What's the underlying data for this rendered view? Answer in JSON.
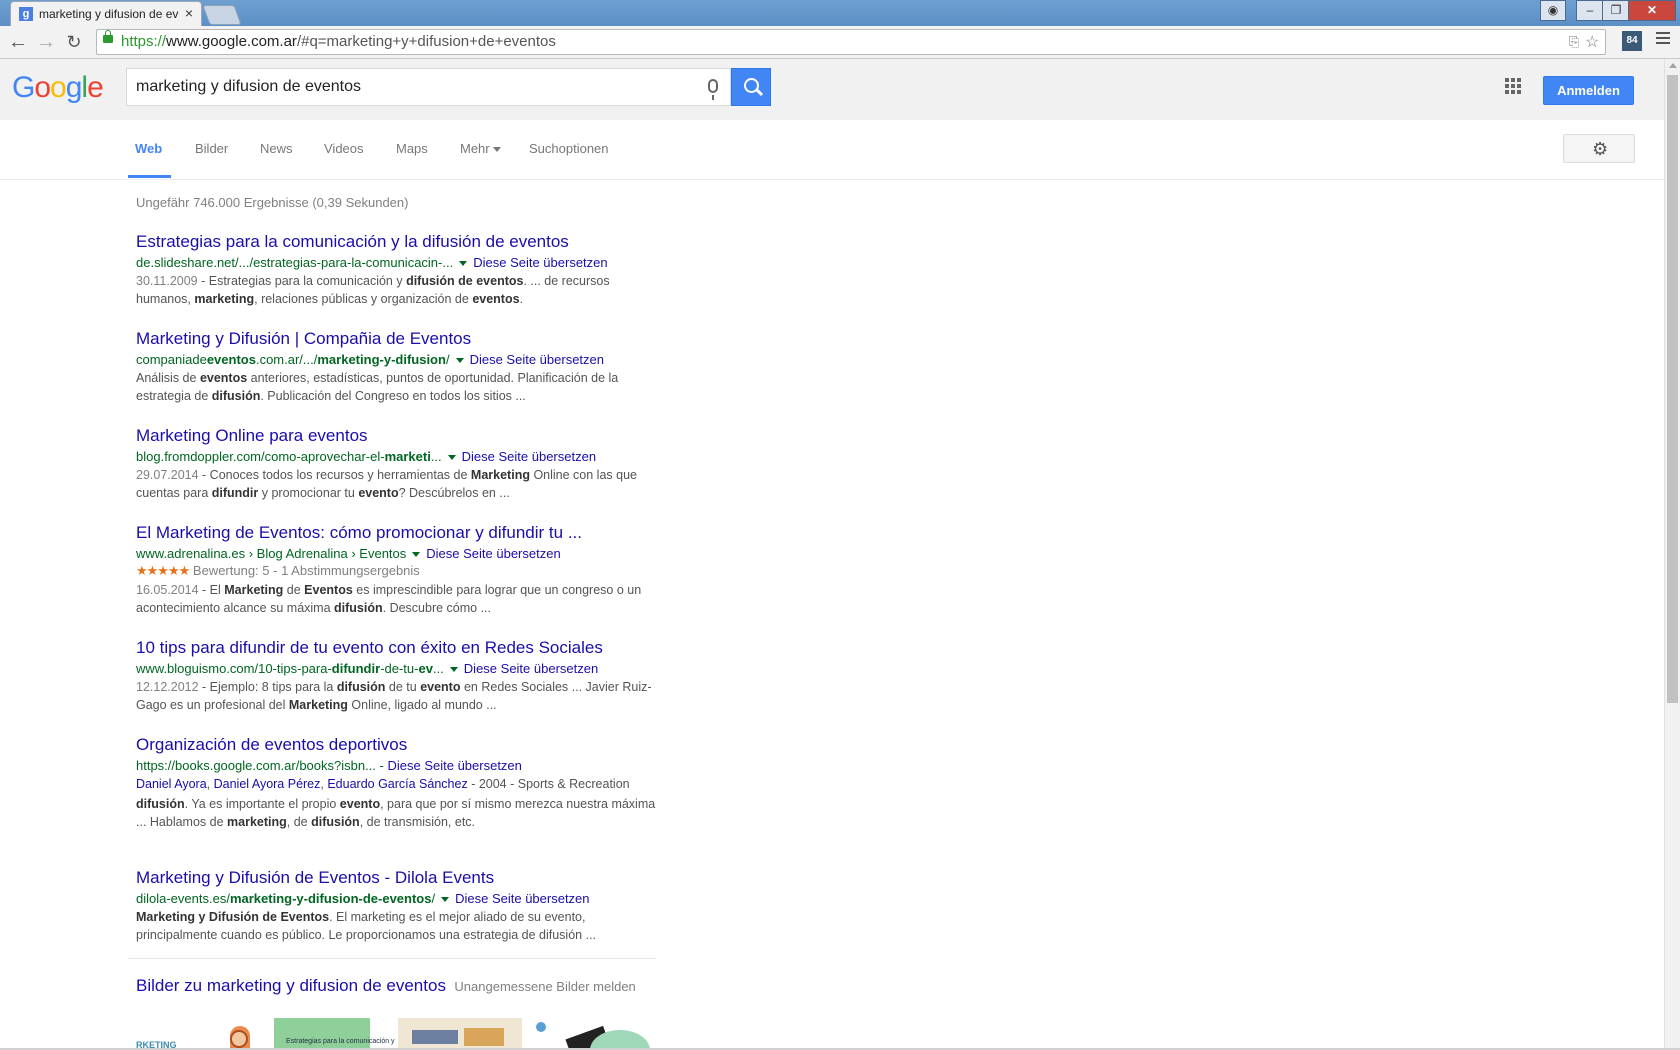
{
  "browser": {
    "tab_title": "marketing y difusion de eventos",
    "favicon_letter": "g",
    "url_scheme": "https://",
    "url_host": "www.google.com.ar",
    "url_path": "/#q=marketing+y+difusion+de+eventos",
    "extension_badge": "84"
  },
  "header": {
    "search_query": "marketing y difusion de eventos",
    "signin_label": "Anmelden"
  },
  "tabs": [
    {
      "label": "Web"
    },
    {
      "label": "Bilder"
    },
    {
      "label": "News"
    },
    {
      "label": "Videos"
    },
    {
      "label": "Maps"
    },
    {
      "label": "Mehr"
    },
    {
      "label": "Suchoptionen"
    }
  ],
  "results_stats": "Ungefähr 746.000 Ergebnisse (0,39 Sekunden)",
  "translate_label": "Diese Seite übersetzen",
  "results": [
    {
      "title": "Estrategias para la comunicación y la difusión de eventos",
      "url": "de.slideshare.net/.../estrategias-para-la-comunicacin-...",
      "date": "30.11.2009",
      "snippet": "Estrategias para la comunicación y <b>difusión de eventos</b>. ... de recursos humanos, <b>marketing</b>, relaciones públicas y organización de <b>eventos</b>."
    },
    {
      "title": "Marketing y Difusión | Compañia de Eventos",
      "url": "companiade<b>eventos</b>.com.ar/.../<b>marketing-y-difusion</b>/",
      "date": "",
      "snippet": "Análisis de <b>eventos</b> anteriores, estadísticas, puntos de oportunidad. Planificación de la estrategia de <b>difusión</b>. Publicación del Congreso en todos los sitios ..."
    },
    {
      "title": "Marketing Online para eventos",
      "url": "blog.fromdoppler.com/como-aprovechar-el-<b>marketi</b>...",
      "date": "29.07.2014",
      "snippet": "Conoces todos los recursos y herramientas de <b>Marketing</b> Online con las que cuentas para <b>difundir</b> y promocionar tu <b>evento</b>? Descúbrelos en ..."
    },
    {
      "title": "El Marketing de Eventos: cómo promocionar y difundir tu ...",
      "url": "www.adrenalina.es › Blog Adrenalina › Eventos",
      "stars": "★★★★★",
      "rating": "Bewertung: 5 - 1 Abstimmungsergebnis",
      "date": "16.05.2014",
      "snippet": "El <b>Marketing</b> de <b>Eventos</b> es imprescindible para lograr que un congreso o un acontecimiento alcance su máxima <b>difusión</b>. Descubre cómo ..."
    },
    {
      "title": "10 tips para difundir de tu evento con éxito en Redes Sociales",
      "url": "www.bloguismo.com/10-tips-para-<b>difundir</b>-de-tu-<b>ev</b>...",
      "date": "12.12.2012",
      "snippet": "Ejemplo: 8 tips para la <b>difusión</b> de tu <b>evento</b> en Redes Sociales ... Javier Ruiz-Gago es un profesional del <b>Marketing</b> Online, ligado al mundo ..."
    },
    {
      "title": "Organización de eventos deportivos",
      "url": "https://books.google.com.ar/books?isbn...",
      "url_sep": " - ",
      "authors": [
        "Daniel Ayora",
        "Daniel Ayora Pérez",
        "Eduardo García Sánchez"
      ],
      "book_meta": " - 2004 - Sports & Recreation",
      "date": "",
      "snippet": "<b>difusión</b>. Ya es importante el propio <b>evento</b>, para que por sí mismo merezca nuestra máxima ... Hablamos de <b>marketing</b>, de <b>difusión</b>, de transmisión, etc."
    },
    {
      "title": "Marketing y Difusión de Eventos - Dilola Events",
      "url": "dilola-events.es/<b>marketing-y-difusion-de-eventos</b>/",
      "date": "",
      "snippet": "<b>Marketing y Difusión de Eventos</b>. El marketing es el mejor aliado de su evento, principalmente cuando es público. Le proporcionamos una estrategia de difusión ..."
    }
  ],
  "images_section": {
    "title": "Bilder zu marketing y difusion de eventos",
    "report": "Unangemessene Bilder melden",
    "thumb1_text": "RKETING",
    "thumb2_text": "Estrategias para la comunicación y"
  },
  "colors": {
    "link": "#1a0dab",
    "url_green": "#006621",
    "accent_blue": "#4285f4",
    "star_orange": "#e7711b"
  }
}
